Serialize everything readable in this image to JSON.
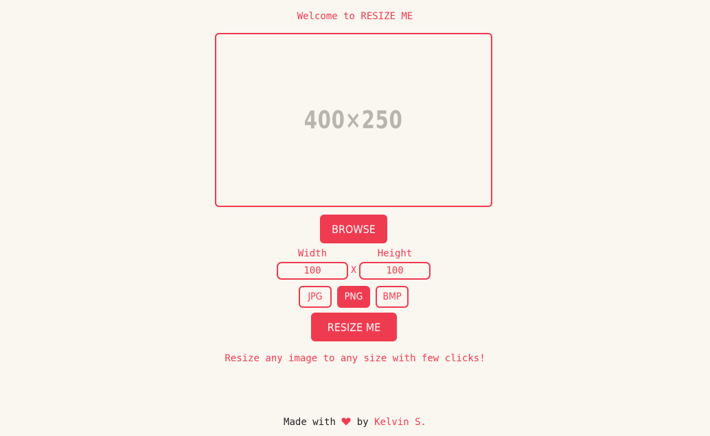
{
  "header": {
    "welcome": "Welcome to RESIZE ME"
  },
  "preview": {
    "placeholder": "400×250"
  },
  "browse": {
    "label": "BROWSE"
  },
  "dimensions": {
    "width_label": "Width",
    "height_label": "Height",
    "width_value": "100",
    "height_value": "100",
    "separator": "X"
  },
  "formats": {
    "options": [
      "JPG",
      "PNG",
      "BMP"
    ],
    "selected": "PNG"
  },
  "resize": {
    "label": "RESIZE ME"
  },
  "tagline": "Resize any image to any size with few clicks!",
  "footer": {
    "made_with": "Made with",
    "heart_icon": "heart-icon",
    "by": "by",
    "author": "Kelvin S."
  },
  "colors": {
    "accent": "#ef3b50",
    "background": "#faf6f0",
    "placeholder_text": "#b8b4ae",
    "footer_text": "#222222"
  }
}
